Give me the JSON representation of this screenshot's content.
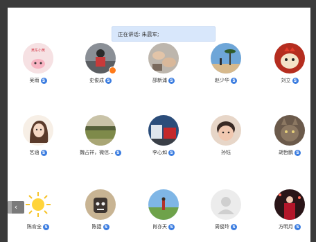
{
  "speaking": {
    "label": "正在讲话:",
    "name": "朱晨军;"
  },
  "participants": [
    {
      "name": "吴雨",
      "badge": "S",
      "avatar": "cartoon-pink-logo"
    },
    {
      "name": "史俊成",
      "badge": "S",
      "avatar": "motorcyclist"
    },
    {
      "name": "邵新浦",
      "badge": "S",
      "avatar": "hands-drawing"
    },
    {
      "name": "赵少华",
      "badge": "S",
      "avatar": "beach-palms"
    },
    {
      "name": "刘立",
      "badge": "S",
      "avatar": "cartoon-rooster"
    },
    {
      "name": "艺涵",
      "badge": "S",
      "avatar": "anime-girl"
    },
    {
      "name": "魏占祥，微信...",
      "badge": "S",
      "avatar": "grass-field"
    },
    {
      "name": "李心如",
      "badge": "S",
      "avatar": "vehicles"
    },
    {
      "name": "孙钰",
      "badge": "",
      "avatar": "baby-face"
    },
    {
      "name": "胡哲鹏",
      "badge": "S",
      "avatar": "cat"
    },
    {
      "name": "陈俞全",
      "badge": "S",
      "avatar": "sun-icon"
    },
    {
      "name": "陈捷",
      "badge": "S",
      "avatar": "robot-cartoon"
    },
    {
      "name": "肖亦天",
      "badge": "S",
      "avatar": "person-field"
    },
    {
      "name": "周俊玲",
      "badge": "S",
      "avatar": "default-user-icon"
    },
    {
      "name": "方明月",
      "badge": "S",
      "avatar": "woman-red-night"
    }
  ],
  "nav": {
    "prev_symbol": "‹"
  }
}
